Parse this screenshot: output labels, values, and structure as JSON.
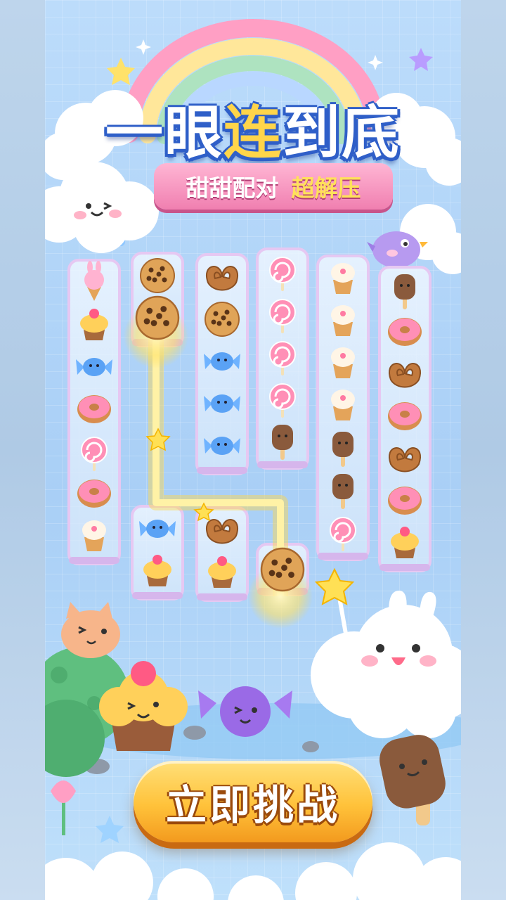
{
  "title": {
    "part1": "一眼",
    "highlight": "连",
    "part2": "到底"
  },
  "subtitle": {
    "part1": "甜甜配对",
    "part2": "超解压"
  },
  "cta_label": "立即挑战",
  "board": {
    "columns": [
      [
        "bunny-icecream",
        "cupcake",
        "candy",
        "donut",
        "lollipop",
        "donut",
        "icecream-cone"
      ],
      [
        "cookie",
        "cookie",
        "",
        "",
        "",
        "",
        "candy",
        "cupcake"
      ],
      [
        "pretzel",
        "cookie",
        "candy",
        "candy",
        "candy",
        "",
        "pretzel",
        "cupcake"
      ],
      [
        "lollipop",
        "lollipop",
        "lollipop",
        "lollipop",
        "popsicle",
        "",
        "",
        "cookie"
      ],
      [
        "icecream-cone",
        "icecream-cone",
        "icecream-cone",
        "icecream-cone",
        "popsicle",
        "popsicle",
        "lollipop"
      ],
      [
        "popsicle",
        "donut",
        "pretzel",
        "donut",
        "pretzel",
        "donut",
        "cupcake"
      ]
    ],
    "connected_pair": "cookie"
  },
  "colors": {
    "accent": "#ffd54a",
    "title_outline": "#2f5fc8",
    "ribbon": "#f07fb0",
    "button": "#ffc23a",
    "path_glow": "#ffd84a"
  }
}
